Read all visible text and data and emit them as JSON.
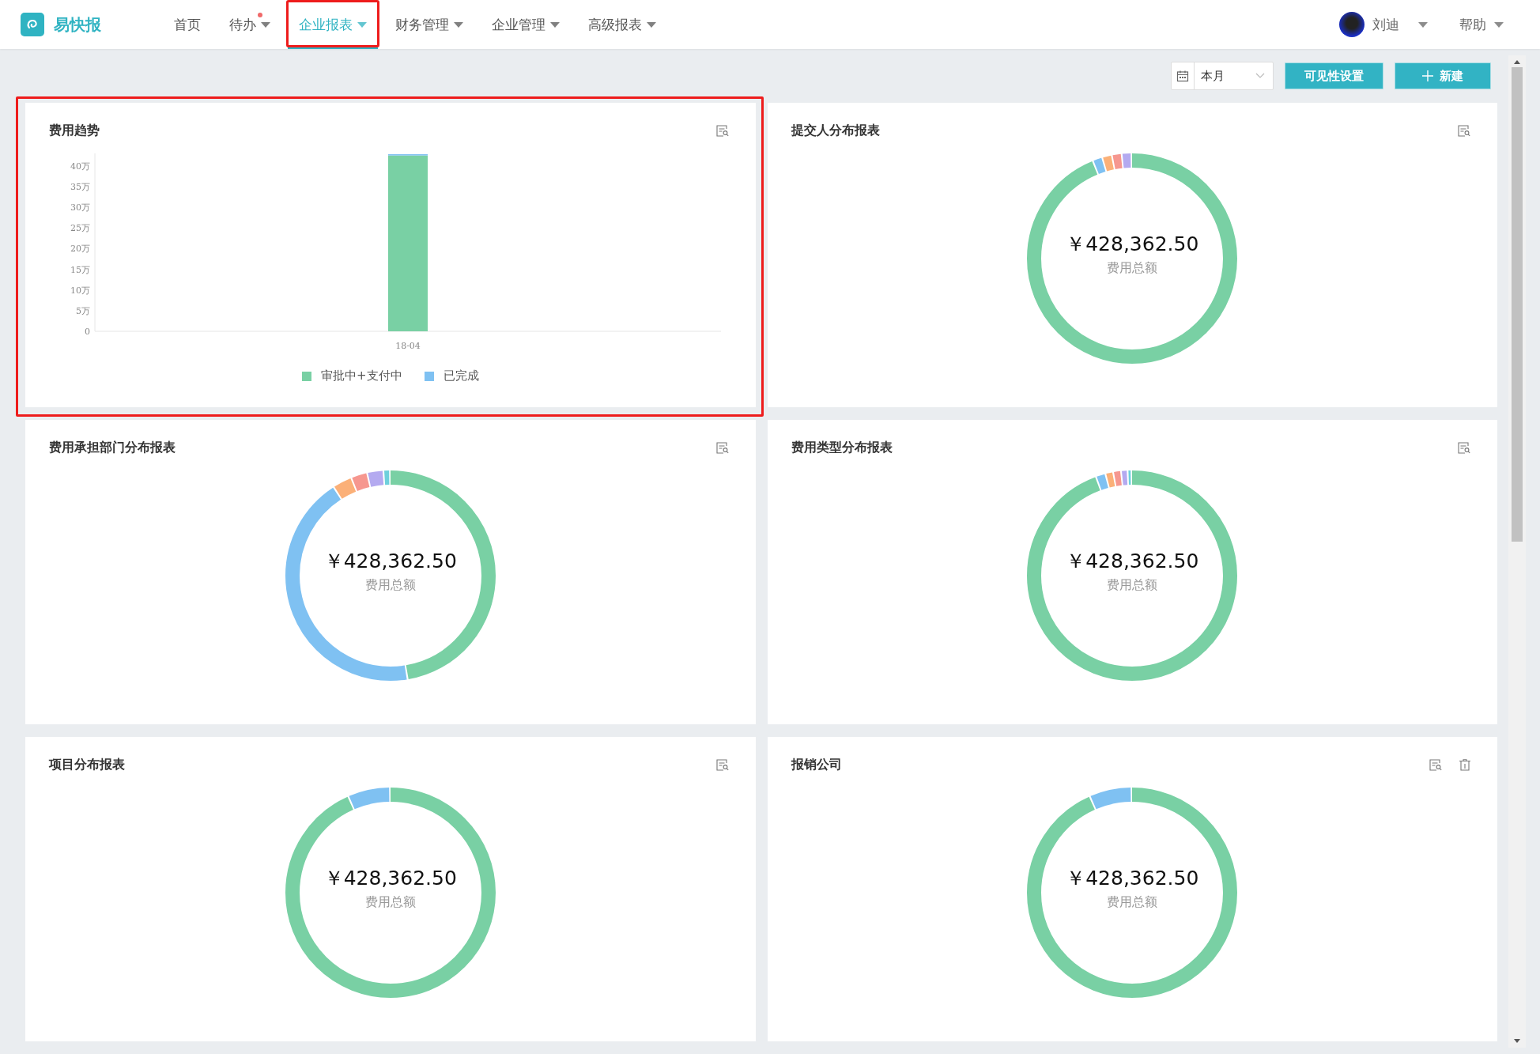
{
  "header": {
    "brand": "易快报",
    "nav": [
      {
        "label": "首页",
        "dropdown": false,
        "selected": false,
        "badge": false,
        "highlighted": false
      },
      {
        "label": "待办",
        "dropdown": true,
        "selected": false,
        "badge": true,
        "highlighted": false
      },
      {
        "label": "企业报表",
        "dropdown": true,
        "selected": true,
        "badge": false,
        "highlighted": true
      },
      {
        "label": "财务管理",
        "dropdown": true,
        "selected": false,
        "badge": false,
        "highlighted": false
      },
      {
        "label": "企业管理",
        "dropdown": true,
        "selected": false,
        "badge": false,
        "highlighted": false
      },
      {
        "label": "高级报表",
        "dropdown": true,
        "selected": false,
        "badge": false,
        "highlighted": false
      }
    ],
    "user": {
      "name": "刘迪"
    },
    "help": "帮助"
  },
  "toolbar": {
    "period": "本月",
    "visibility_button": "可见性设置",
    "new_button": "新建"
  },
  "cards": [
    {
      "title": "费用趋势",
      "kind": "bar",
      "highlighted": true,
      "deletable": false,
      "chart_data": {
        "type": "bar",
        "categories": [
          "18-04"
        ],
        "stacked": true,
        "ylim": [
          0,
          43
        ],
        "yticks": [
          {
            "value": 0,
            "label": "0"
          },
          {
            "value": 5,
            "label": "5万"
          },
          {
            "value": 10,
            "label": "10万"
          },
          {
            "value": 15,
            "label": "15万"
          },
          {
            "value": 20,
            "label": "20万"
          },
          {
            "value": 25,
            "label": "25万"
          },
          {
            "value": 30,
            "label": "30万"
          },
          {
            "value": 35,
            "label": "35万"
          },
          {
            "value": 40,
            "label": "40万"
          }
        ],
        "series": [
          {
            "name": "审批中+支付中",
            "color": "#79d0a4",
            "values": [
              42.5
            ]
          },
          {
            "name": "已完成",
            "color": "#7fc1f2",
            "values": [
              0.3
            ]
          }
        ]
      }
    },
    {
      "title": "提交人分布报表",
      "kind": "donut",
      "highlighted": false,
      "deletable": false,
      "total": "￥428,362.50",
      "caption": "费用总额"
    },
    {
      "title": "费用承担部门分布报表",
      "kind": "donut",
      "highlighted": false,
      "deletable": false,
      "total": "￥428,362.50",
      "caption": "费用总额"
    },
    {
      "title": "费用类型分布报表",
      "kind": "donut",
      "highlighted": false,
      "deletable": false,
      "total": "￥428,362.50",
      "caption": "费用总额"
    },
    {
      "title": "项目分布报表",
      "kind": "donut",
      "highlighted": false,
      "deletable": false,
      "total": "￥428,362.50",
      "caption": "费用总额"
    },
    {
      "title": "报销公司",
      "kind": "donut",
      "highlighted": false,
      "deletable": true,
      "total": "￥428,362.50",
      "caption": "费用总额"
    }
  ]
}
